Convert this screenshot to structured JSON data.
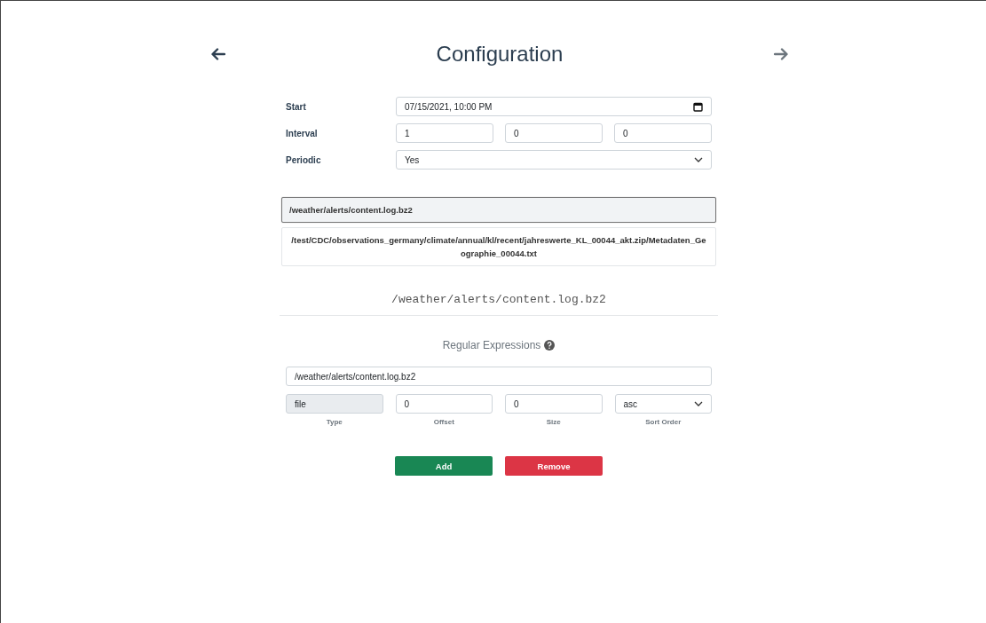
{
  "header": {
    "title": "Configuration",
    "back": {
      "disabled": false
    },
    "forward": {
      "disabled": true
    }
  },
  "form": [
    {
      "label": "Start",
      "kind": "datetime",
      "value": "07/15/2021, 10:00 PM"
    },
    {
      "label": "Interval",
      "kind": "triple",
      "values": [
        "1",
        "0",
        "0"
      ]
    },
    {
      "label": "Periodic",
      "kind": "select",
      "value": "Yes"
    }
  ],
  "paths": [
    {
      "text": "/weather/alerts/content.log.bz2",
      "selected": true
    },
    {
      "text": "/test/CDC/observations_germany/climate/annual/kl/recent/jahreswerte_KL_00044_akt.zip/Metadaten_Geographie_00044.txt",
      "selected": false
    }
  ],
  "current_path": "/weather/alerts/content.log.bz2",
  "regex": {
    "heading": "Regular Expressions",
    "pattern": "/weather/alerts/content.log.bz2",
    "fields": [
      {
        "label": "Type",
        "kind": "readonly",
        "value": "file"
      },
      {
        "label": "Offset",
        "kind": "text",
        "value": "0"
      },
      {
        "label": "Size",
        "kind": "text",
        "value": "0"
      },
      {
        "label": "Sort Order",
        "kind": "select",
        "value": "asc"
      }
    ]
  },
  "buttons": [
    {
      "label": "Add",
      "kind": "success"
    },
    {
      "label": "Remove",
      "kind": "danger"
    }
  ]
}
